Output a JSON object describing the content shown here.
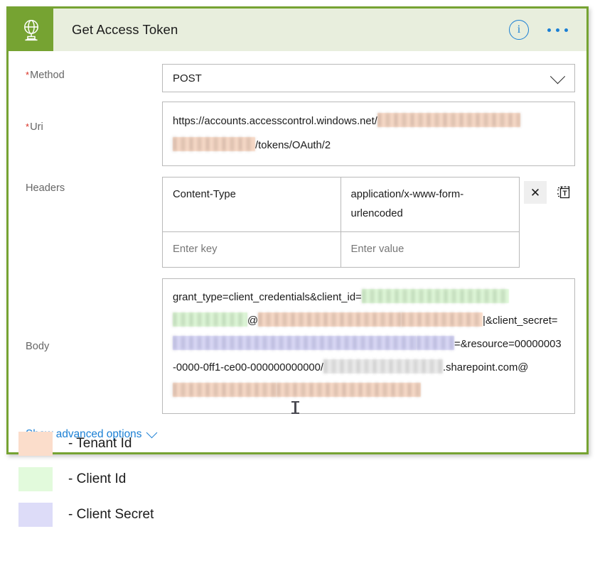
{
  "card": {
    "icon": "globe-http-icon",
    "title": "Get Access Token",
    "accent_color": "#76a332",
    "header_bg": "#e8eedd",
    "info_icon": "info-circle-icon",
    "more_icon": "ellipsis-icon"
  },
  "fields": {
    "method": {
      "label": "Method",
      "required_marker": "*",
      "value": "POST",
      "chevron": "chevron-down-icon"
    },
    "uri": {
      "label": "Uri",
      "required_marker": "*",
      "part1": "https://accounts.accesscontrol.windows.net/",
      "redacted1": "tenant-id",
      "redacted2": "tenant-id",
      "part2": "/tokens/OAuth/2"
    },
    "headers": {
      "label": "Headers",
      "rows": [
        {
          "key": "Content-Type",
          "value": "application/x-www-form-urlencoded"
        }
      ],
      "placeholder_key": "Enter key",
      "placeholder_value": "Enter value",
      "delete_icon": "close-icon",
      "text_mode_icon": "switch-to-text-mode-icon"
    },
    "body": {
      "label": "Body",
      "seg1": "grant_type=client_credentials&client_id=",
      "seg2": "@",
      "seg3": "|&client_secret=",
      "seg4": "=&resource=00000003-0000-0ff1-ce00-000000000000/",
      "seg5": ".sharepoint.com@"
    }
  },
  "advanced": {
    "label": "Show advanced options",
    "chevron": "chevron-down-icon"
  },
  "legend": {
    "items": [
      {
        "label": "- Tenant Id",
        "color": "#fbddcb"
      },
      {
        "label": "- Client Id",
        "color": "#e2fadc"
      },
      {
        "label": "- Client Secret",
        "color": "#dddcf8"
      }
    ]
  }
}
